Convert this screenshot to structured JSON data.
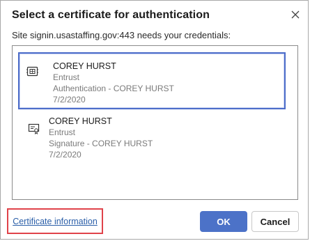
{
  "dialog": {
    "title": "Select a certificate for authentication",
    "subtitle": "Site signin.usastaffing.gov:443 needs your credentials:"
  },
  "certificates": [
    {
      "name": "COREY HURST",
      "issuer": "Entrust",
      "purpose": "Authentication - COREY HURST",
      "date": "7/2/2020",
      "icon": "chip-card-icon",
      "selected": true
    },
    {
      "name": "COREY HURST",
      "issuer": "Entrust",
      "purpose": "Signature - COREY HURST",
      "date": "7/2/2020",
      "icon": "certificate-icon",
      "selected": false
    }
  ],
  "footer": {
    "link_label": "Certificate information",
    "ok_label": "OK",
    "cancel_label": "Cancel"
  },
  "colors": {
    "accent": "#4c72c8",
    "selection_border": "#4c6cc9",
    "highlight_red": "#e0434a",
    "link": "#2a5ea8"
  }
}
